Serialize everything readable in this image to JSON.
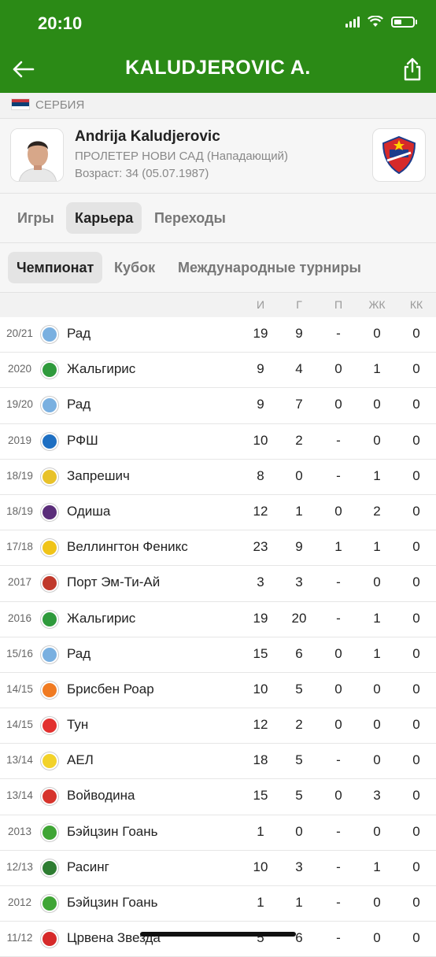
{
  "status": {
    "time": "20:10"
  },
  "header": {
    "title": "KALUDJEROVIC A.",
    "back_icon": "arrow-left-icon",
    "share_icon": "share-icon",
    "bg_color": "#2b8a16"
  },
  "country": {
    "name": "СЕРБИЯ",
    "flag": "serbia-flag-icon"
  },
  "player": {
    "name": "Andrija Kaludjerovic",
    "team_position": "ПРОЛЕТЕР НОВИ САД (Нападающий)",
    "age": "Возраст: 34 (05.07.1987)"
  },
  "tabs": [
    "Игры",
    "Карьера",
    "Переходы"
  ],
  "active_tab": "Карьера",
  "subtabs": [
    "Чемпионат",
    "Кубок",
    "Международные турниры"
  ],
  "active_subtab": "Чемпионат",
  "columns": [
    "И",
    "Г",
    "П",
    "ЖК",
    "КК"
  ],
  "rows": [
    {
      "season": "20/21",
      "team": "Рад",
      "color": "#7ab0e0",
      "i": "19",
      "g": "9",
      "p": "-",
      "zk": "0",
      "kk": "0"
    },
    {
      "season": "2020",
      "team": "Жальгирис",
      "color": "#2f9a3c",
      "i": "9",
      "g": "4",
      "p": "0",
      "zk": "1",
      "kk": "0"
    },
    {
      "season": "19/20",
      "team": "Рад",
      "color": "#7ab0e0",
      "i": "9",
      "g": "7",
      "p": "0",
      "zk": "0",
      "kk": "0"
    },
    {
      "season": "2019",
      "team": "РФШ",
      "color": "#1e6fc2",
      "i": "10",
      "g": "2",
      "p": "-",
      "zk": "0",
      "kk": "0"
    },
    {
      "season": "18/19",
      "team": "Запрешич",
      "color": "#e8c22a",
      "i": "8",
      "g": "0",
      "p": "-",
      "zk": "1",
      "kk": "0"
    },
    {
      "season": "18/19",
      "team": "Одиша",
      "color": "#5a2d7a",
      "i": "12",
      "g": "1",
      "p": "0",
      "zk": "2",
      "kk": "0"
    },
    {
      "season": "17/18",
      "team": "Веллингтон Феникс",
      "color": "#f0c419",
      "i": "23",
      "g": "9",
      "p": "1",
      "zk": "1",
      "kk": "0"
    },
    {
      "season": "2017",
      "team": "Порт Эм-Ти-Ай",
      "color": "#c0392b",
      "i": "3",
      "g": "3",
      "p": "-",
      "zk": "0",
      "kk": "0"
    },
    {
      "season": "2016",
      "team": "Жальгирис",
      "color": "#2f9a3c",
      "i": "19",
      "g": "20",
      "p": "-",
      "zk": "1",
      "kk": "0"
    },
    {
      "season": "15/16",
      "team": "Рад",
      "color": "#7ab0e0",
      "i": "15",
      "g": "6",
      "p": "0",
      "zk": "1",
      "kk": "0"
    },
    {
      "season": "14/15",
      "team": "Брисбен Роар",
      "color": "#f07b22",
      "i": "10",
      "g": "5",
      "p": "0",
      "zk": "0",
      "kk": "0"
    },
    {
      "season": "14/15",
      "team": "Тун",
      "color": "#e2312f",
      "i": "12",
      "g": "2",
      "p": "0",
      "zk": "0",
      "kk": "0"
    },
    {
      "season": "13/14",
      "team": "АЕЛ",
      "color": "#f2d22a",
      "i": "18",
      "g": "5",
      "p": "-",
      "zk": "0",
      "kk": "0"
    },
    {
      "season": "13/14",
      "team": "Войводина",
      "color": "#d6342c",
      "i": "15",
      "g": "5",
      "p": "0",
      "zk": "3",
      "kk": "0"
    },
    {
      "season": "2013",
      "team": "Бэйцзин Гоань",
      "color": "#3fa535",
      "i": "1",
      "g": "0",
      "p": "-",
      "zk": "0",
      "kk": "0"
    },
    {
      "season": "12/13",
      "team": "Расинг",
      "color": "#2e7d32",
      "i": "10",
      "g": "3",
      "p": "-",
      "zk": "1",
      "kk": "0"
    },
    {
      "season": "2012",
      "team": "Бэйцзин Гоань",
      "color": "#3fa535",
      "i": "1",
      "g": "1",
      "p": "-",
      "zk": "0",
      "kk": "0"
    },
    {
      "season": "11/12",
      "team": "Црвена Звезда",
      "color": "#d62a2a",
      "i": "5",
      "g": "6",
      "p": "-",
      "zk": "0",
      "kk": "0"
    }
  ]
}
